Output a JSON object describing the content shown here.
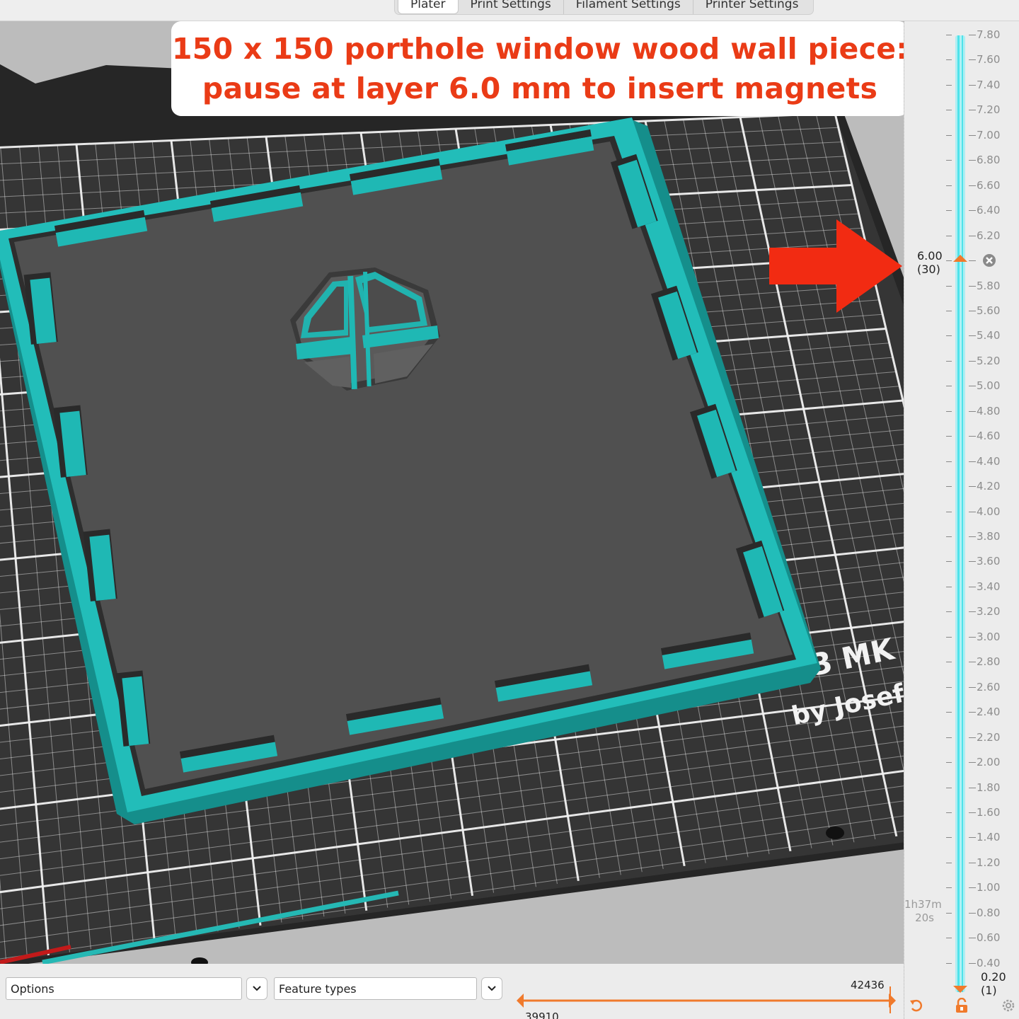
{
  "tabs": [
    {
      "label": "Plater",
      "active": true
    },
    {
      "label": "Print Settings",
      "active": false
    },
    {
      "label": "Filament Settings",
      "active": false
    },
    {
      "label": "Printer Settings",
      "active": false
    }
  ],
  "annotation": {
    "line1": "150 x 150 porthole window wood wall piece:",
    "line2": "pause at layer 6.0 mm to insert magnets",
    "color": "#ea3b16",
    "arrow_color": "#f22b12"
  },
  "bed": {
    "label_line1": "3 MK",
    "label_line2": "by Josef"
  },
  "layer_slider": {
    "ticks": [
      "7.80",
      "7.60",
      "7.40",
      "7.20",
      "7.00",
      "6.80",
      "6.60",
      "6.40",
      "6.20",
      "6.00",
      "5.80",
      "5.60",
      "5.40",
      "5.20",
      "5.00",
      "4.80",
      "4.60",
      "4.40",
      "4.20",
      "4.00",
      "3.80",
      "3.60",
      "3.40",
      "3.20",
      "3.00",
      "2.80",
      "2.60",
      "2.40",
      "2.20",
      "2.00",
      "1.80",
      "1.60",
      "1.40",
      "1.20",
      "1.00",
      "0.80",
      "0.60",
      "0.40"
    ],
    "upper_value": "6.00",
    "upper_layer": "(30)",
    "lower_value": "0.20",
    "lower_layer": "(1)",
    "estimated_time_line1": "1h37m",
    "estimated_time_line2": "20s",
    "track_color": "#4fe2ea",
    "thumb_color": "#f07a2c"
  },
  "bottom_bar": {
    "options_label": "Options",
    "feature_types_label": "Feature types",
    "move_slider_max": "42436",
    "move_slider_min": "39910"
  },
  "colors": {
    "print_teal": "#1fb8b4",
    "bed_dark": "#353535",
    "grid_line": "#f2f2f2",
    "accent_orange": "#f07a2c"
  }
}
